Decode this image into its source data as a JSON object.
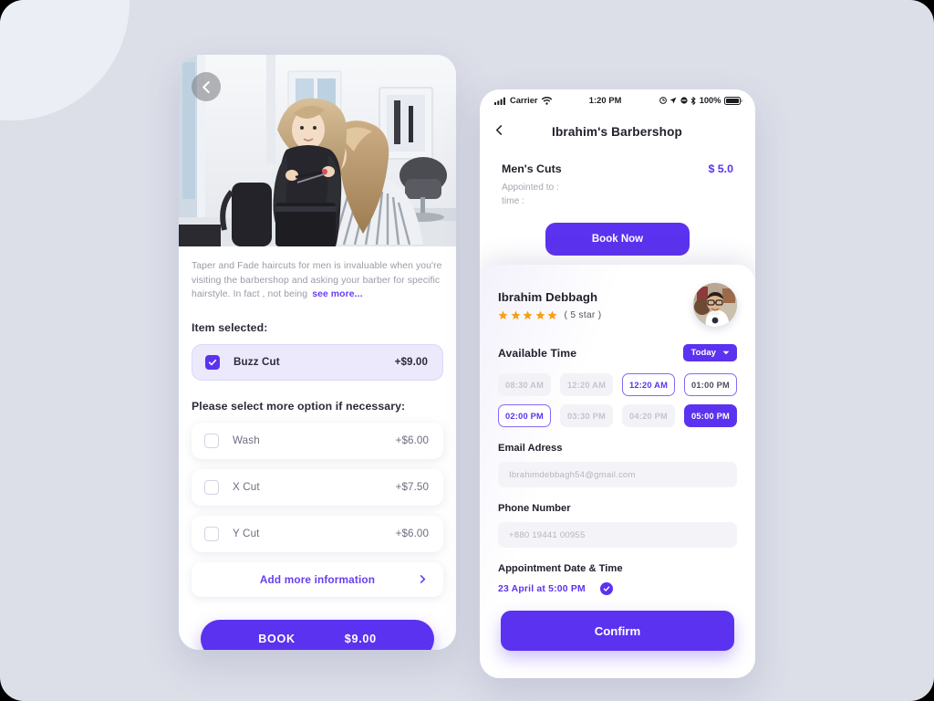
{
  "left_phone": {
    "back_icon": "chevron-left-icon",
    "description": "Taper and Fade haircuts for men is invaluable when you're visiting the barbershop and asking your barber for specific hairstyle.  In fact , not being",
    "see_more": "see more...",
    "selected_title": "Item selected:",
    "selected_item": {
      "label": "Buzz Cut",
      "price": "+$9.00",
      "checked": true
    },
    "more_options_title": "Please select more option if necessary:",
    "options": [
      {
        "label": "Wash",
        "price": "+$6.00",
        "checked": false
      },
      {
        "label": "X Cut",
        "price": "+$7.50",
        "checked": false
      },
      {
        "label": "Y Cut",
        "price": "+$6.00",
        "checked": false
      }
    ],
    "add_more": {
      "label": "Add more information",
      "chevron": "chevron-right-icon"
    },
    "book": {
      "label": "BOOK",
      "total": "$9.00"
    }
  },
  "right_phone": {
    "status_bar": {
      "carrier": "Carrier",
      "time": "1:20 PM",
      "battery_percent": "100%",
      "icons": [
        "signal-bars-icon",
        "wifi-icon",
        "alarm-icon",
        "location-arrow-icon",
        "do-not-disturb-icon",
        "bluetooth-icon",
        "battery-icon"
      ]
    },
    "nav": {
      "back_icon": "chevron-left-icon",
      "title": "Ibrahim's Barbershop"
    },
    "service": {
      "name": "Men's Cuts",
      "price": "$ 5.0",
      "appointed_to": "Appointed to :",
      "time": "time :",
      "hidden_button_label": "Book Now"
    },
    "barber": {
      "name": "Ibrahim Debbagh",
      "rating_stars": 5,
      "rating_label": "( 5 star )",
      "avatar": "barber-avatar"
    },
    "available_time": {
      "label": "Available Time",
      "day_filter": "Today",
      "day_filter_icon": "chevron-down-icon",
      "slots": [
        {
          "time": "08:30 AM",
          "state": "off"
        },
        {
          "time": "12:20 AM",
          "state": "off"
        },
        {
          "time": "12:20 AM",
          "state": "outline-accent"
        },
        {
          "time": "01:00 PM",
          "state": "outline-dark"
        },
        {
          "time": "02:00 PM",
          "state": "outline-accent"
        },
        {
          "time": "03:30 PM",
          "state": "off"
        },
        {
          "time": "04:20 PM",
          "state": "off"
        },
        {
          "time": "05:00 PM",
          "state": "filled"
        }
      ]
    },
    "email": {
      "label": "Email Adress",
      "placeholder": "Ibrahimdebbagh54@gmail.com",
      "value": ""
    },
    "phone": {
      "label": "Phone Number",
      "placeholder": "+880 19441 00955",
      "value": ""
    },
    "appointment": {
      "label": "Appointment Date & Time",
      "value": "23 April  at  5:00 PM",
      "confirmed_icon": "check-circle-icon"
    },
    "confirm_button": "Confirm"
  },
  "colors": {
    "accent": "#5b32ef",
    "accent_light": "#8a68f5",
    "page_bg": "#dcdee8",
    "star": "#f5a118"
  }
}
